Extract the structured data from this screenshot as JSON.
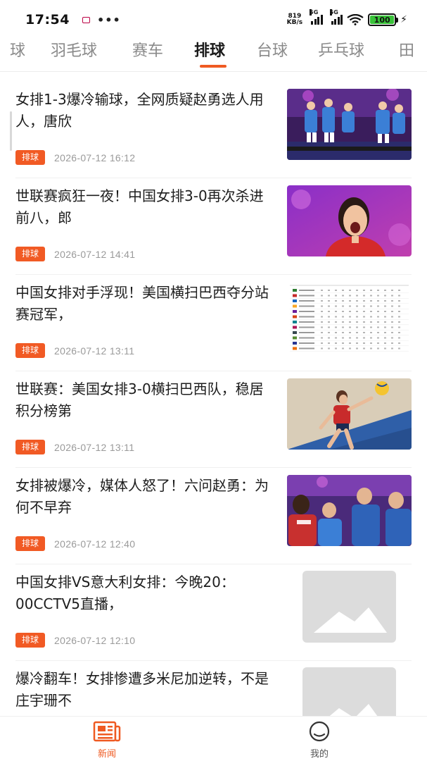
{
  "status_bar": {
    "time": "17:54",
    "net_speed_value": "819",
    "net_speed_unit": "KB/s",
    "signal1_label": "5G",
    "signal2_label": "5G",
    "battery": "100"
  },
  "tabs": {
    "items": [
      "球",
      "羽毛球",
      "赛车",
      "排球",
      "台球",
      "乒乓球",
      "田"
    ],
    "active": "排球"
  },
  "news": [
    {
      "title": "女排1-3爆冷输球，全网质疑赵勇选人用人，唐欣",
      "tag": "排球",
      "time": "2026-07-12 16:12",
      "image": "team-celebration-photo"
    },
    {
      "title": "世联赛疯狂一夜！中国女排3-0再次杀进前八，郎",
      "tag": "排球",
      "time": "2026-07-12 14:41",
      "image": "player-shouting-photo"
    },
    {
      "title": "中国女排对手浮现！美国横扫巴西夺分站赛冠军，",
      "tag": "排球",
      "time": "2026-07-12 13:11",
      "image": "standings-table-image"
    },
    {
      "title": "世联赛：美国女排3-0横扫巴西队，稳居积分榜第",
      "tag": "排球",
      "time": "2026-07-12 13:11",
      "image": "player-spiking-photo"
    },
    {
      "title": "女排被爆冷，媒体人怒了！六问赵勇：为何不早弃",
      "tag": "排球",
      "time": "2026-07-12 12:40",
      "image": "coach-timeout-photo"
    },
    {
      "title": "中国女排VS意大利女排：今晚20：00CCTV5直播，",
      "tag": "排球",
      "time": "2026-07-12 12:10",
      "image": "placeholder-image"
    },
    {
      "title": "爆冷翻车！女排惨遭多米尼加逆转，不是庄宇珊不",
      "tag": "",
      "time": "",
      "image": "placeholder-image"
    }
  ],
  "bottom_nav": {
    "news_label": "新闻",
    "mine_label": "我的",
    "active": "新闻"
  },
  "colors": {
    "accent": "#ef5a22",
    "badge": "#f15a24",
    "placeholder": "#dcdcdc"
  }
}
